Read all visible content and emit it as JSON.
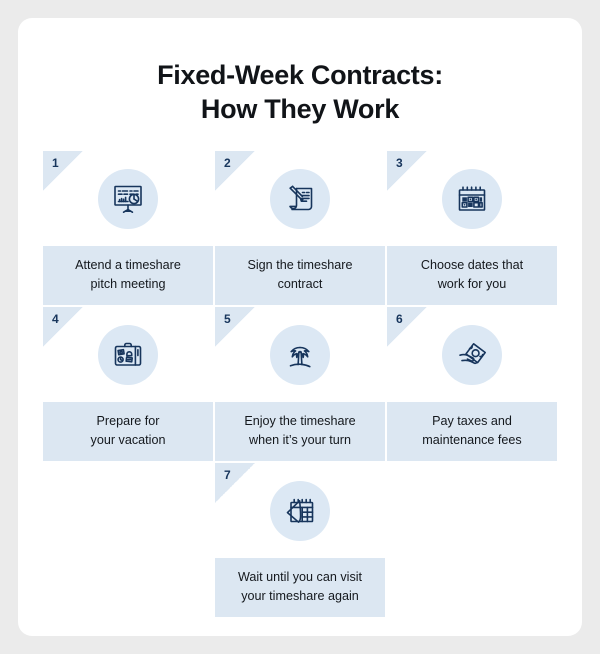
{
  "page": {
    "background_color": "#ebebeb",
    "card_color": "#ffffff"
  },
  "title": {
    "line1": "Fixed-Week Contracts:",
    "line2": "How They Work",
    "color": "#111418"
  },
  "theme": {
    "accent_light": "#dce7f2",
    "icon_circle": "#dce8f4",
    "icon_stroke": "#17355c",
    "number_color": "#17355c",
    "caption_text": "#14181d"
  },
  "steps": [
    {
      "number": "1",
      "icon": "presentation-chart-icon",
      "caption_line1": "Attend a timeshare",
      "caption_line2": "pitch meeting"
    },
    {
      "number": "2",
      "icon": "sign-contract-pen-icon",
      "caption_line1": "Sign the timeshare",
      "caption_line2": "contract"
    },
    {
      "number": "3",
      "icon": "calendar-icon",
      "caption_line1": "Choose dates that",
      "caption_line2": "work for you"
    },
    {
      "number": "4",
      "icon": "suitcase-icon",
      "caption_line1": "Prepare for",
      "caption_line2": "your vacation"
    },
    {
      "number": "5",
      "icon": "palm-tree-icon",
      "caption_line1": "Enjoy the timeshare",
      "caption_line2": "when it’s your turn"
    },
    {
      "number": "6",
      "icon": "hand-holding-money-icon",
      "caption_line1": "Pay taxes and",
      "caption_line2": "maintenance fees"
    },
    {
      "number": "7",
      "icon": "calendar-page-turn-icon",
      "caption_line1": "Wait until you can visit",
      "caption_line2": "your timeshare again"
    }
  ]
}
